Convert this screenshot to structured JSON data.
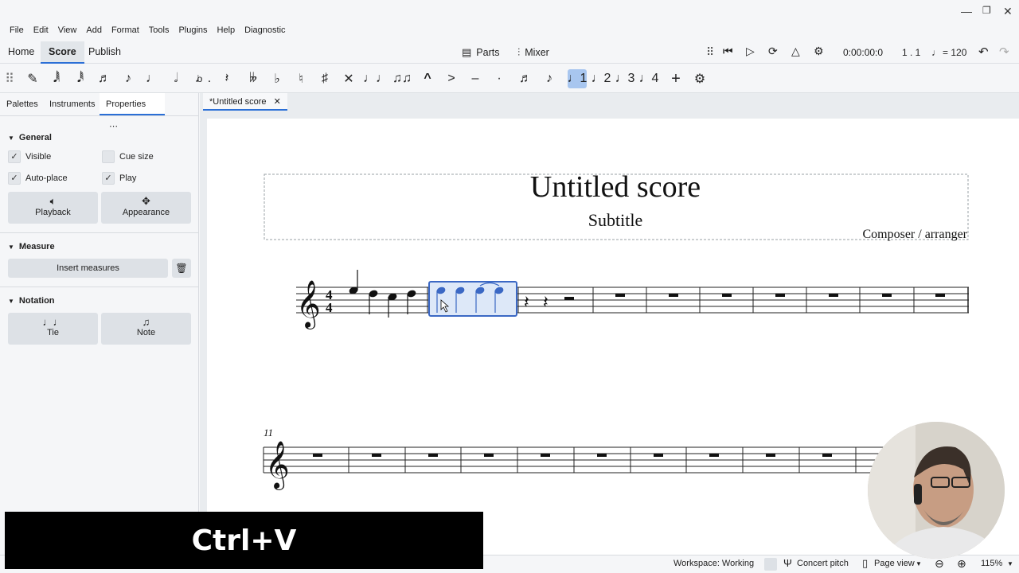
{
  "menus": [
    "File",
    "Edit",
    "View",
    "Add",
    "Format",
    "Tools",
    "Plugins",
    "Help",
    "Diagnostic"
  ],
  "workspace_tabs": [
    "Home",
    "Score",
    "Publish"
  ],
  "center_buttons": {
    "parts": "Parts",
    "mixer": "Mixer"
  },
  "playback": {
    "time": "0:00:00:0",
    "position": "1 . 1",
    "tempo": "= 120"
  },
  "toolbar_active": "voice-1",
  "panel_tabs": [
    "Palettes",
    "Instruments",
    "Properties"
  ],
  "properties": {
    "general": "General",
    "visible": "Visible",
    "cue_size": "Cue size",
    "auto_place": "Auto-place",
    "play": "Play",
    "playback": "Playback",
    "appearance": "Appearance",
    "measure": "Measure",
    "insert_measures": "Insert measures",
    "notation": "Notation",
    "tie": "Tie",
    "note": "Note"
  },
  "document_tab": "*Untitled score",
  "score": {
    "title": "Untitled score",
    "subtitle": "Subtitle",
    "composer": "Composer / arranger",
    "time_sig_top": "4",
    "time_sig_bottom": "4",
    "system2_measure_number": "11"
  },
  "status": {
    "workspace": "Workspace: Working",
    "concert_pitch": "Concert pitch",
    "page_view": "Page view",
    "zoom": "115%"
  },
  "key_overlay": "Ctrl+V",
  "colors": {
    "accent": "#2b6fd6",
    "selection": "#3b68c4"
  }
}
